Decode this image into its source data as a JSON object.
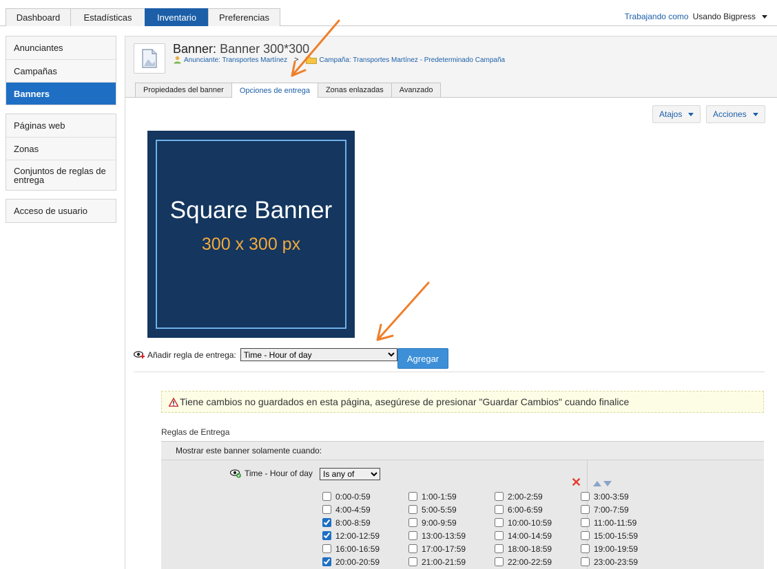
{
  "topnav": {
    "tabs": [
      {
        "label": "Dashboard"
      },
      {
        "label": "Estadísticas"
      },
      {
        "label": "Inventario"
      },
      {
        "label": "Preferencias"
      }
    ],
    "working_label": "Trabajando como",
    "user": "Usando Bigpress"
  },
  "sidebar": {
    "group1": [
      "Anunciantes",
      "Campañas",
      "Banners"
    ],
    "group2": [
      "Páginas web",
      "Zonas",
      "Conjuntos de reglas de entrega"
    ],
    "group3": [
      "Acceso de usuario"
    ]
  },
  "header": {
    "title_prefix": "Banner:",
    "title_name": "Banner 300*300",
    "advertiser": "Anunciante: Transportes Martínez",
    "separator": ">",
    "campaign": "Campaña: Transportes Martínez - Predeterminado Campaña"
  },
  "subtabs": [
    {
      "label": "Propiedades del banner"
    },
    {
      "label": "Opciones de entrega"
    },
    {
      "label": "Zonas enlazadas"
    },
    {
      "label": "Avanzado"
    }
  ],
  "actions": {
    "shortcuts": "Atajos",
    "actions": "Acciones"
  },
  "creative": {
    "line1": "Square Banner",
    "line2": "300 x 300 px",
    "bg_color": "#14365f",
    "accent_color": "#f2a93b"
  },
  "add_rule": {
    "label": "Añadir regla de entrega:",
    "selected": "Time - Hour of day",
    "button": "Agregar"
  },
  "warning": "Tiene cambios no guardados en esta página, asegúrese de presionar \"Guardar Cambios\" cuando finalice",
  "rules": {
    "title": "Reglas de Entrega",
    "header": "Mostrar este banner solamente cuando:",
    "rule_name": "Time - Hour of day",
    "operator": "Is any of",
    "hours": [
      {
        "label": "0:00-0:59",
        "checked": false
      },
      {
        "label": "1:00-1:59",
        "checked": false
      },
      {
        "label": "2:00-2:59",
        "checked": false
      },
      {
        "label": "3:00-3:59",
        "checked": false
      },
      {
        "label": "4:00-4:59",
        "checked": false
      },
      {
        "label": "5:00-5:59",
        "checked": false
      },
      {
        "label": "6:00-6:59",
        "checked": false
      },
      {
        "label": "7:00-7:59",
        "checked": false
      },
      {
        "label": "8:00-8:59",
        "checked": true
      },
      {
        "label": "9:00-9:59",
        "checked": false
      },
      {
        "label": "10:00-10:59",
        "checked": false
      },
      {
        "label": "11:00-11:59",
        "checked": false
      },
      {
        "label": "12:00-12:59",
        "checked": true
      },
      {
        "label": "13:00-13:59",
        "checked": false
      },
      {
        "label": "14:00-14:59",
        "checked": false
      },
      {
        "label": "15:00-15:59",
        "checked": false
      },
      {
        "label": "16:00-16:59",
        "checked": false
      },
      {
        "label": "17:00-17:59",
        "checked": false
      },
      {
        "label": "18:00-18:59",
        "checked": false
      },
      {
        "label": "19:00-19:59",
        "checked": false
      },
      {
        "label": "20:00-20:59",
        "checked": true
      },
      {
        "label": "21:00-21:59",
        "checked": false
      },
      {
        "label": "22:00-22:59",
        "checked": false
      },
      {
        "label": "23:00-23:59",
        "checked": false
      }
    ]
  },
  "colors": {
    "primary": "#1c5fa8",
    "active_sidebar": "#1e6fc4",
    "arrow": "#f07f2a",
    "button": "#3d8fd8"
  }
}
